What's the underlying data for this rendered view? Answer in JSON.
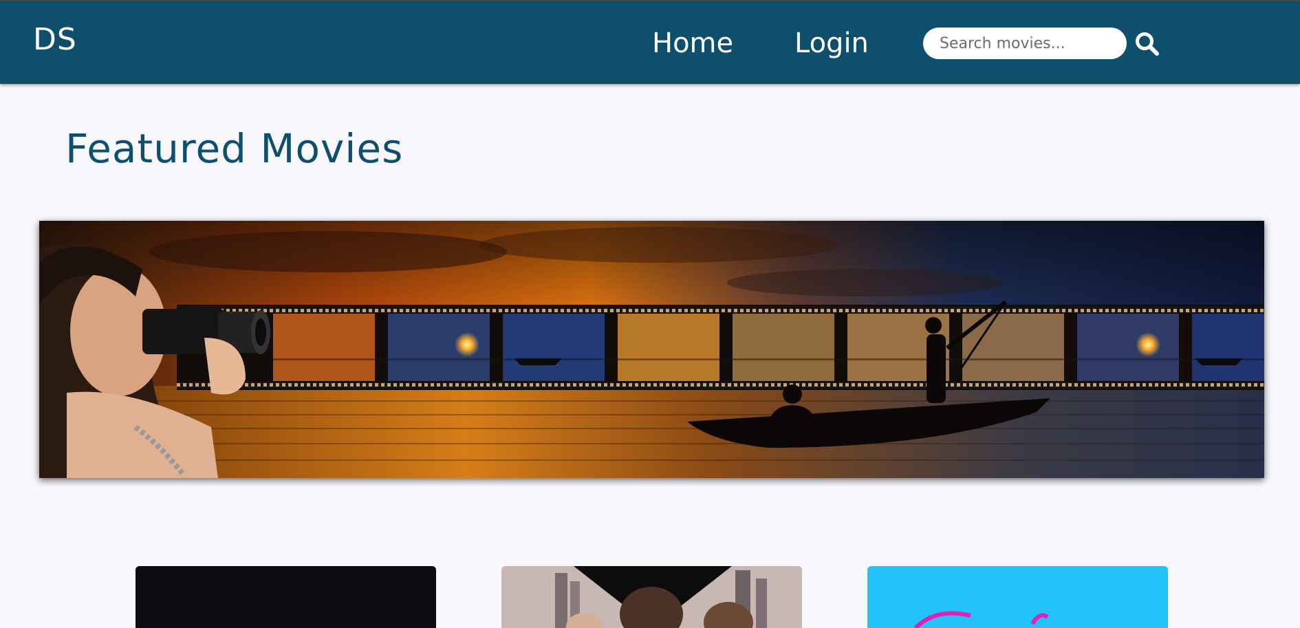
{
  "navbar": {
    "logo": "DS",
    "links": [
      {
        "label": "Home"
      },
      {
        "label": "Login"
      }
    ],
    "search": {
      "placeholder": "Search movies...",
      "value": ""
    },
    "bg_color": "#0e4f6d"
  },
  "main": {
    "title": "Featured Movies"
  },
  "icons": {
    "search": "search-icon"
  }
}
